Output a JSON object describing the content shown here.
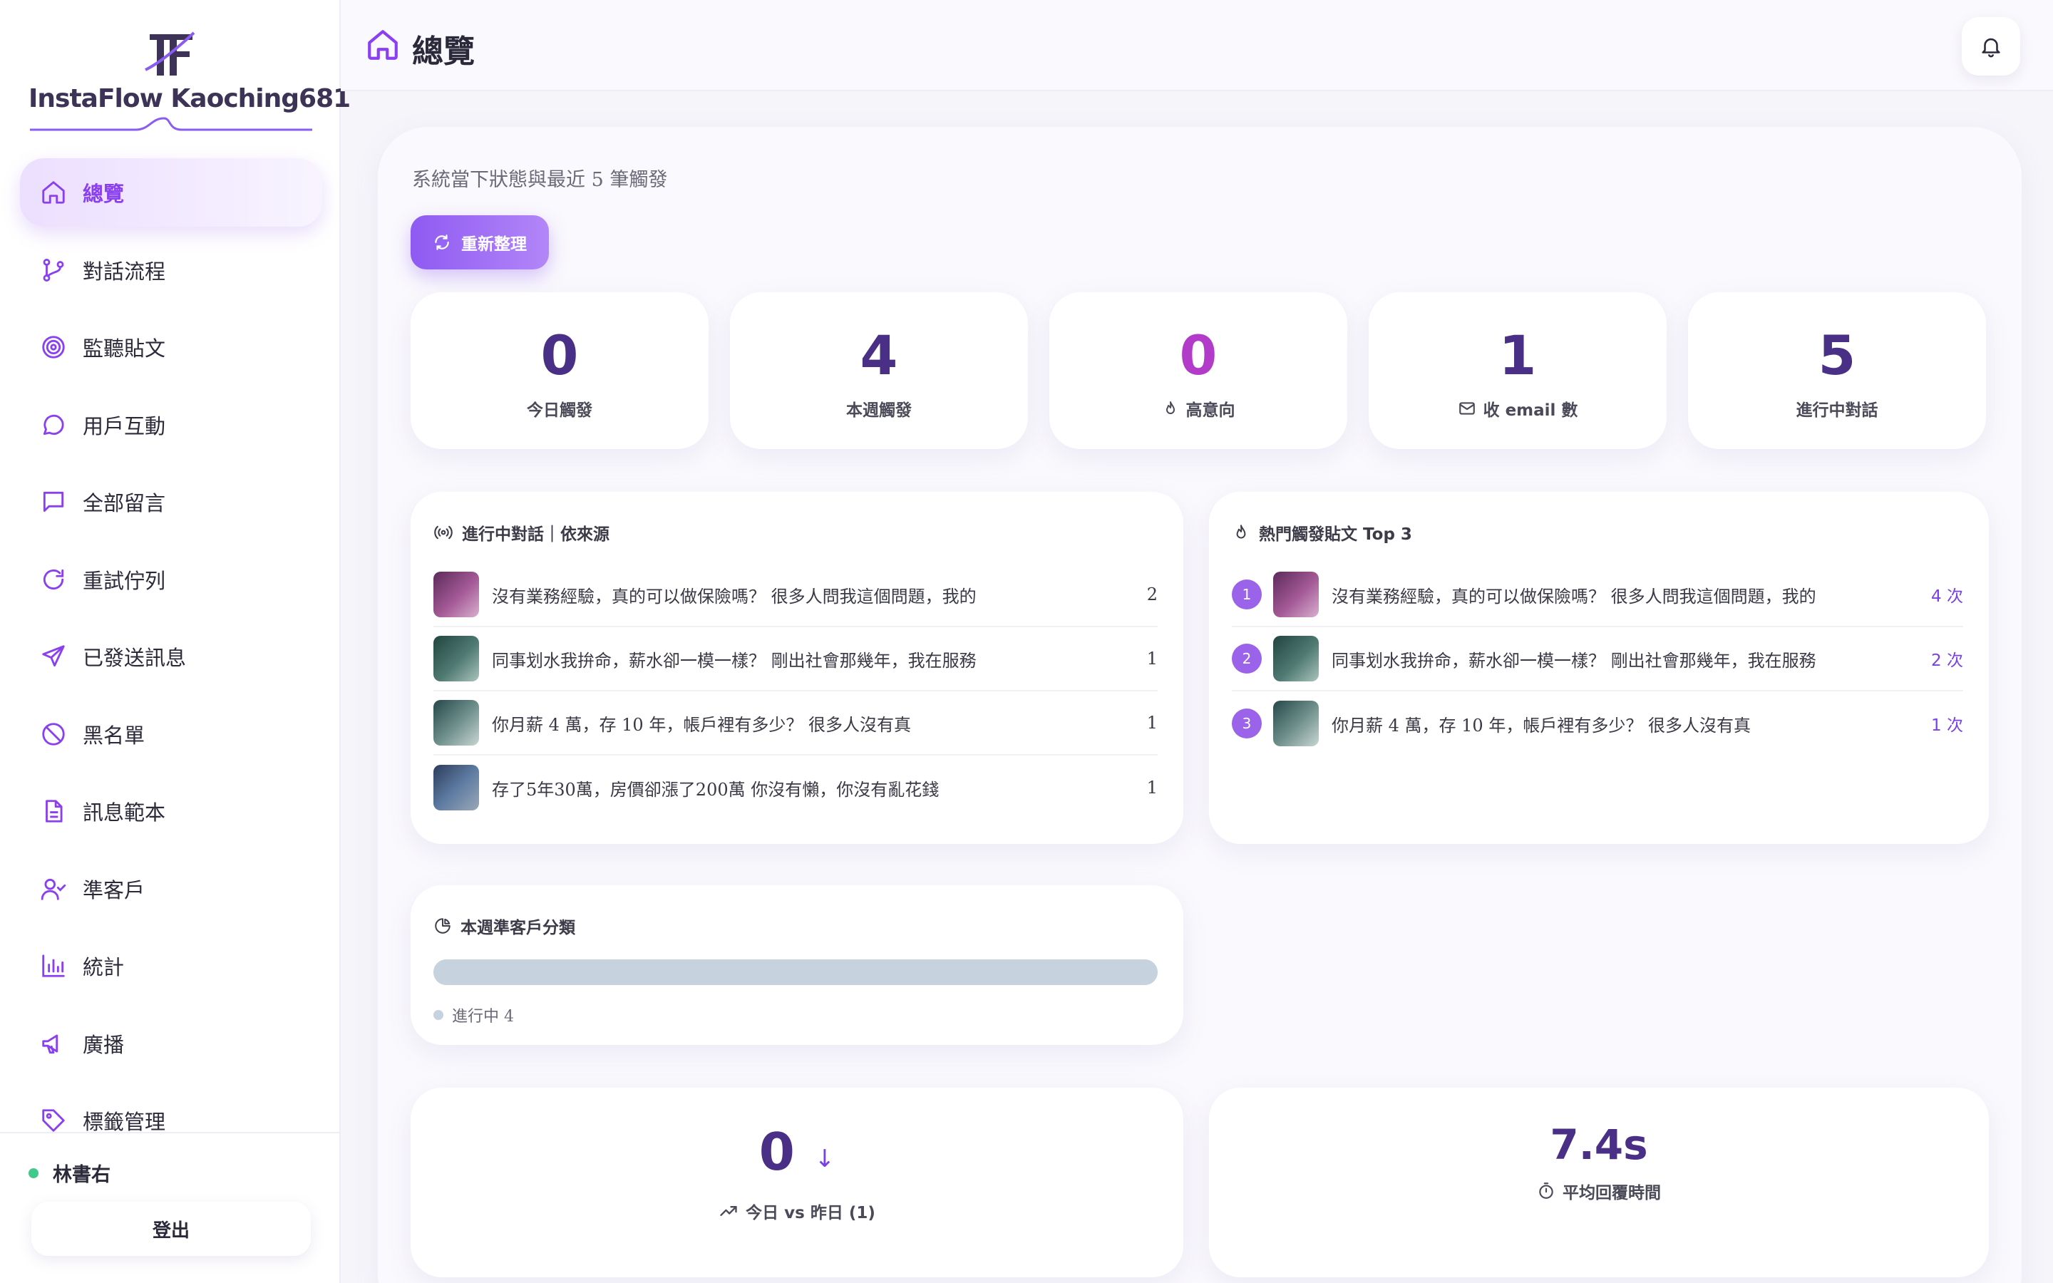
{
  "brand": {
    "name": "InstaFlow Kaoching681"
  },
  "sidebar": {
    "items": [
      {
        "label": "總覽",
        "icon": "home-icon",
        "active": true
      },
      {
        "label": "對話流程",
        "icon": "git-branch-icon"
      },
      {
        "label": "監聽貼文",
        "icon": "target-icon"
      },
      {
        "label": "用戶互動",
        "icon": "chat-bubble-icon"
      },
      {
        "label": "全部留言",
        "icon": "message-square-icon"
      },
      {
        "label": "重試佇列",
        "icon": "rotate-icon"
      },
      {
        "label": "已發送訊息",
        "icon": "send-icon"
      },
      {
        "label": "黑名單",
        "icon": "ban-icon"
      },
      {
        "label": "訊息範本",
        "icon": "file-text-icon"
      },
      {
        "label": "準客戶",
        "icon": "user-check-icon"
      },
      {
        "label": "統計",
        "icon": "bar-chart-icon"
      },
      {
        "label": "廣播",
        "icon": "megaphone-icon"
      },
      {
        "label": "標籤管理",
        "icon": "tag-icon"
      }
    ],
    "user": {
      "name": "林書右",
      "status_color": "#41c98b"
    },
    "logout_label": "登出"
  },
  "header": {
    "title": "總覽",
    "icon": "home-icon"
  },
  "main": {
    "subtitle": "系統當下狀態與最近 5 筆觸發",
    "refresh_label": "重新整理",
    "stats": [
      {
        "value": "0",
        "label": "今日觸發"
      },
      {
        "value": "4",
        "label": "本週觸發"
      },
      {
        "value": "0",
        "label": "高意向",
        "icon": "flame-icon"
      },
      {
        "value": "1",
        "label": "收 email 數",
        "icon": "mail-icon"
      },
      {
        "value": "5",
        "label": "進行中對話"
      }
    ],
    "active_conversations": {
      "title": "進行中對話｜依來源",
      "items": [
        {
          "text": "沒有業務經驗，真的可以做保險嗎？ 很多人問我這個問題，我的",
          "count": "2"
        },
        {
          "text": "同事划水我拚命，薪水卻一模一樣？ 剛出社會那幾年，我在服務",
          "count": "1"
        },
        {
          "text": "你月薪 4 萬，存 10 年，帳戶裡有多少？ 很多人沒有真",
          "count": "1"
        },
        {
          "text": "存了5年30萬，房價卻漲了200萬 你沒有懶，你沒有亂花錢",
          "count": "1"
        }
      ]
    },
    "hot_posts": {
      "title": "熱門觸發貼文 Top 3",
      "items": [
        {
          "rank": "1",
          "text": "沒有業務經驗，真的可以做保險嗎？ 很多人問我這個問題，我的",
          "count": "4 次"
        },
        {
          "rank": "2",
          "text": "同事划水我拚命，薪水卻一模一樣？ 剛出社會那幾年，我在服務",
          "count": "2 次"
        },
        {
          "rank": "3",
          "text": "你月薪 4 萬，存 10 年，帳戶裡有多少？ 很多人沒有真",
          "count": "1 次"
        }
      ]
    },
    "prospects": {
      "title": "本週準客戶分類",
      "legend_label": "進行中 4",
      "fill_fraction": 1.0
    },
    "today_vs_yesterday": {
      "value": "0",
      "arrow": "↓",
      "label": "今日 vs 昨日 (1)"
    },
    "avg_reply": {
      "value": "7.4s",
      "label": "平均回覆時間"
    }
  },
  "colors": {
    "accent": "#8a3ff0",
    "stat_value": "#4a2f86",
    "stat_highlight": "#b23cc9",
    "online": "#41c98b",
    "progress": "#c6d2de"
  }
}
